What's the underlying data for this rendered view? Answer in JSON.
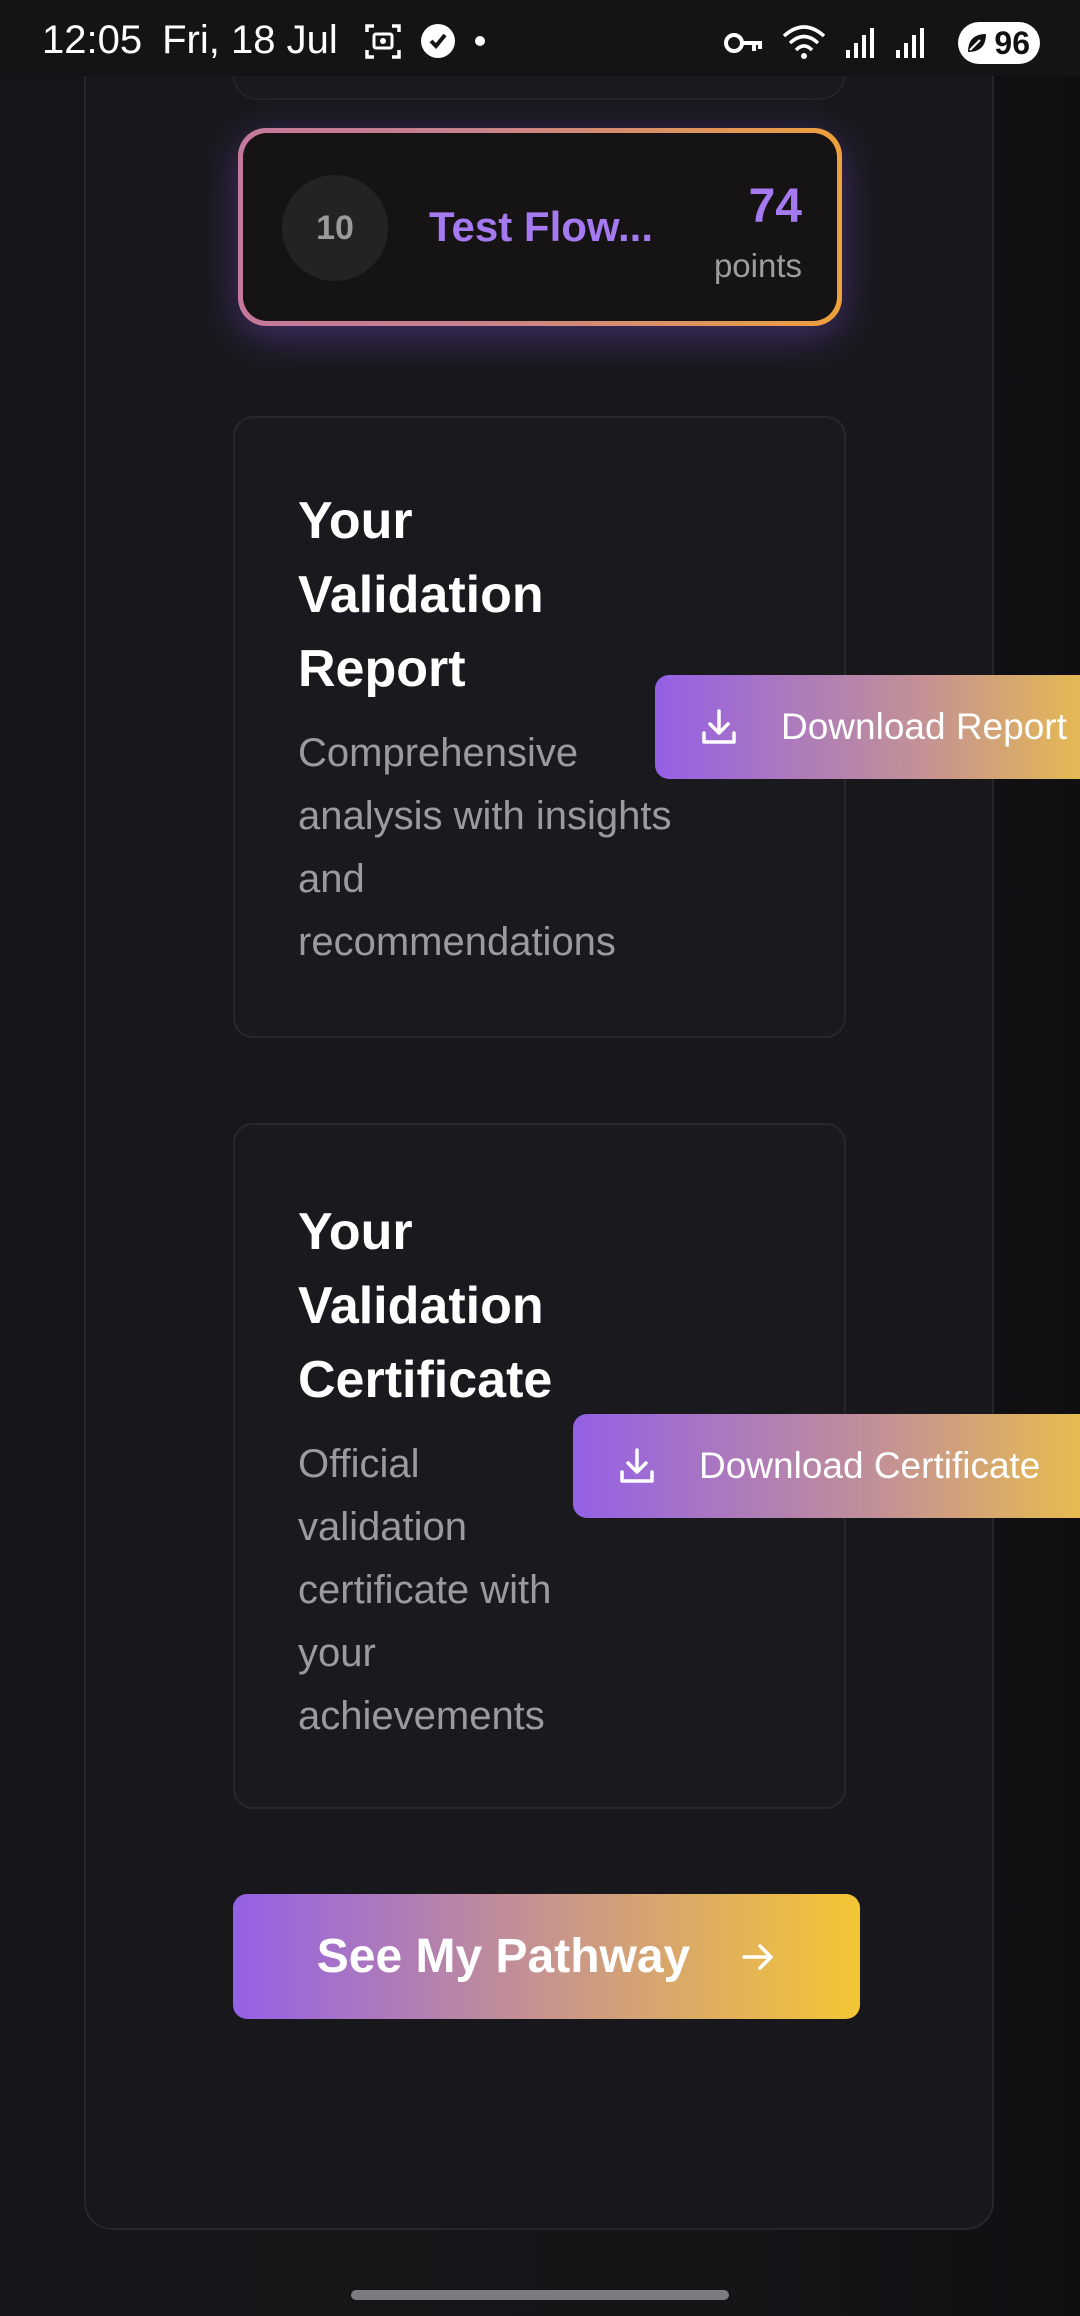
{
  "status_bar": {
    "time": "12:05",
    "date": "Fri, 18 Jul",
    "battery": "96",
    "icons": [
      "screenshot-icon",
      "check-badge-icon",
      "dot-icon",
      "vpn-key-icon",
      "wifi-icon",
      "signal-icon",
      "signal-icon",
      "battery-icon"
    ]
  },
  "leaderboard_row": {
    "rank": "10",
    "name": "Test Flow...",
    "points_value": "74",
    "points_label": "points"
  },
  "report_card": {
    "title": "Your Validation Report",
    "description": "Comprehensive analysis with insights and recommendations",
    "button_label": "Download Report",
    "button_icon": "download-icon"
  },
  "certificate_card": {
    "title": "Your Validation Certificate",
    "description": "Official validation certificate with your achievements",
    "button_label": "Download Certificate",
    "button_icon": "download-icon"
  },
  "pathway_button": {
    "label": "See My Pathway",
    "icon": "arrow-right-icon"
  },
  "colors": {
    "accent_purple": "#a57af0",
    "gradient_start": "#9460e6",
    "gradient_end": "#f0c63c",
    "background": "#18181c"
  }
}
